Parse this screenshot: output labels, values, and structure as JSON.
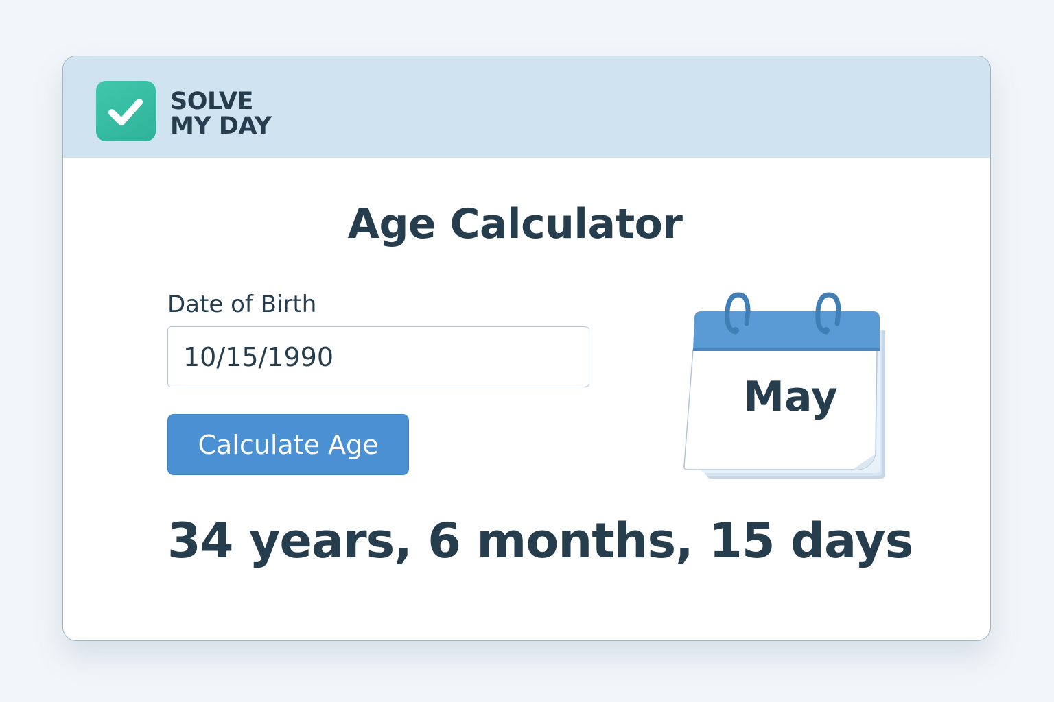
{
  "brand": {
    "line1": "SOLVE",
    "line2": "MY DAY",
    "logo_icon": "checkmark-icon"
  },
  "page": {
    "title": "Age Calculator"
  },
  "form": {
    "dob_label": "Date of Birth",
    "dob_value": "10/15/1990",
    "submit_label": "Calculate Age"
  },
  "calendar": {
    "icon": "calendar-icon",
    "month": "May"
  },
  "result": {
    "text": "34 years, 6 months, 15 days"
  },
  "colors": {
    "header_bg": "#cfe3f1",
    "accent_green": "#34bb9f",
    "button_blue": "#4a90d2",
    "text_dark": "#263d4e"
  }
}
